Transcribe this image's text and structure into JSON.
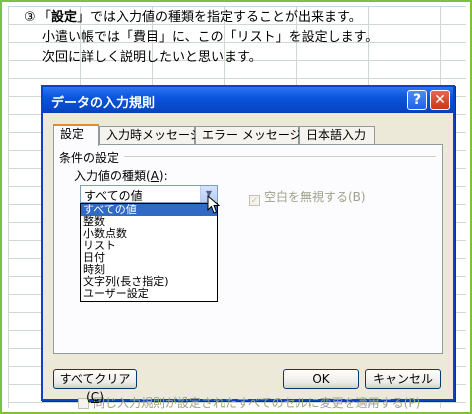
{
  "intro": {
    "marker": "③",
    "line1_quote_open": "「",
    "line1_bold": "設定",
    "line1_rest": "」では入力値の種類を指定することが出来ます。",
    "line2": "小遣い帳では「費目」に、この「リスト」を設定します。",
    "line3": "次回に詳しく説明したいと思います。"
  },
  "dialog": {
    "title": "データの入力規則",
    "help_glyph": "?",
    "close_glyph": "✕",
    "tabs": [
      "設定",
      "入力時メッセージ",
      "エラー メッセージ",
      "日本語入力"
    ],
    "active_tab": 0,
    "group_label": "条件の設定",
    "field_label_prefix": "入力値の種類(",
    "field_label_key": "A",
    "field_label_suffix": "):",
    "combo_value": "すべての値",
    "list_options": [
      "すべての値",
      "整数",
      "小数点数",
      "リスト",
      "日付",
      "時刻",
      "文字列(長さ指定)",
      "ユーザー設定"
    ],
    "selected_option": 0,
    "ignore_blank_label": "空白を無視する(B)",
    "ignore_blank_checked": true,
    "apply_all_label": "同じ入力規則が設定されたすべてのセルに変更を適用する(P)",
    "apply_all_checked": false,
    "clear_button_prefix": "すべてクリア(",
    "clear_button_key": "C",
    "clear_button_suffix": ")",
    "ok_label": "OK",
    "cancel_label": "キャンセル"
  },
  "colors": {
    "frame_green": "#7dc142",
    "title_blue": "#0a55dd",
    "selection_blue": "#316ac5"
  }
}
